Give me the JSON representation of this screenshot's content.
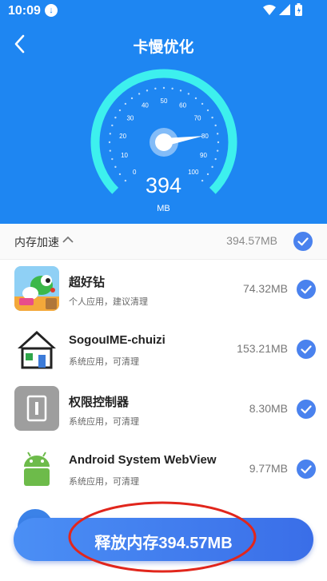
{
  "status_bar": {
    "time": "10:09",
    "download_icon": "download-icon",
    "wifi_icon": "wifi-icon",
    "signal_icon": "signal-icon",
    "battery_icon": "battery-icon"
  },
  "header": {
    "title": "卡慢优化",
    "back_icon": "back-icon",
    "color": "#1e86f2"
  },
  "gauge": {
    "ticks": [
      "0",
      "10",
      "20",
      "30",
      "40",
      "50",
      "60",
      "70",
      "80",
      "90",
      "100"
    ],
    "reading": "394",
    "unit": "MB",
    "needle_fraction": 0.8,
    "arc_color": "#3df0ee"
  },
  "section": {
    "label": "内存加速",
    "total": "394.57MB",
    "checked": true,
    "expanded": true
  },
  "apps": [
    {
      "name": "超好钻",
      "desc": "个人应用，建议清理",
      "size": "74.32MB",
      "checked": true,
      "icon": "yoshi-game-icon"
    },
    {
      "name": "SogouIME-chuizi",
      "desc": "系统应用，可清理",
      "size": "153.21MB",
      "checked": true,
      "icon": "house-icon"
    },
    {
      "name": "权限控制器",
      "desc": "系统应用，可清理",
      "size": "8.30MB",
      "checked": true,
      "icon": "permission-controller-icon"
    },
    {
      "name": "Android System WebView",
      "desc": "系统应用，可清理",
      "size": "9.77MB",
      "checked": true,
      "icon": "android-icon"
    }
  ],
  "footer_button": {
    "label": "释放内存394.57MB",
    "accent": "#4b8ff5",
    "annotation_color": "#e1261c"
  }
}
